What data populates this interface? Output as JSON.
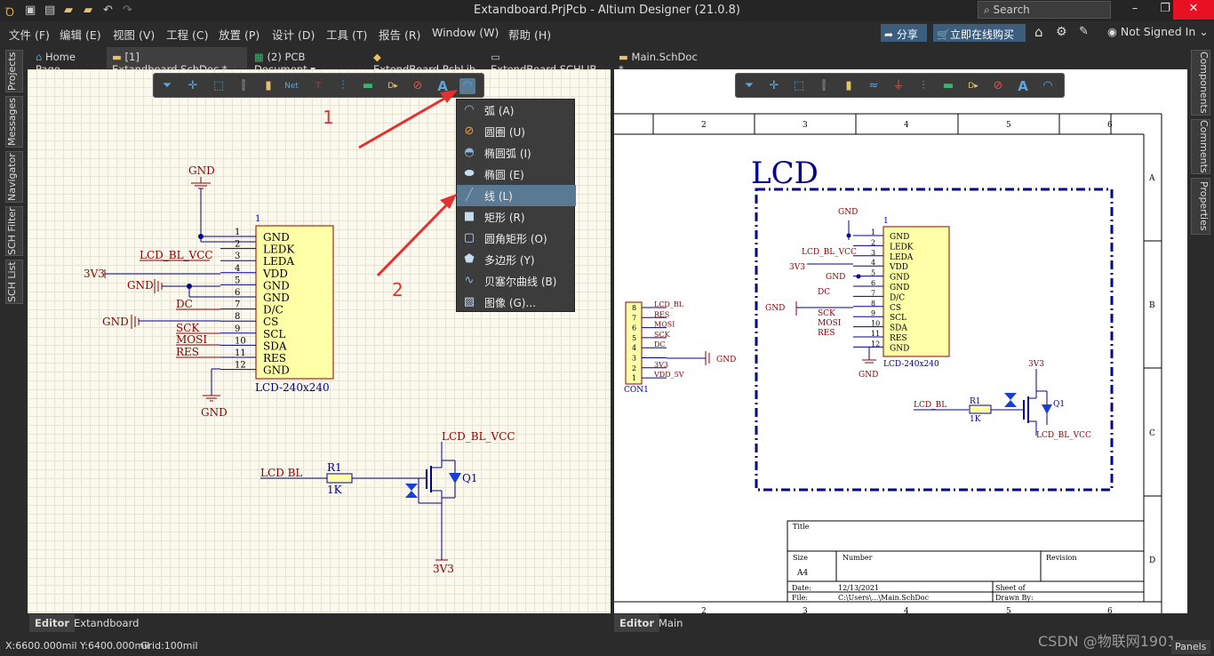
{
  "window": {
    "title": "Extandboard.PrjPcb - Altium Designer (21.0.8)",
    "search_placeholder": "Search",
    "min": "–",
    "max": "❐",
    "close": "✕"
  },
  "menu": {
    "items": [
      "文件 (F)",
      "编辑 (E)",
      "视图 (V)",
      "工程 (C)",
      "放置 (P)",
      "设计 (D)",
      "工具 (T)",
      "报告 (R)",
      "Window (W)",
      "帮助 (H)"
    ],
    "share": "分享",
    "buy": "立即在线购买",
    "user": "Not Signed In"
  },
  "tabs": [
    "Home Page",
    "[1] Extandboard.SchDoc *",
    "(2) PCB Document",
    "ExtendBoard.PcbLib",
    "ExtendBoard.SCHLIB",
    "Main.SchDoc *"
  ],
  "left_panels": [
    "Projects",
    "Messages",
    "Navigator",
    "SCH Filter",
    "SCH List"
  ],
  "right_panels": [
    "Components",
    "Comments",
    "Properties"
  ],
  "dropdown": {
    "items": [
      {
        "label": "弧 (A)",
        "icon": "arc-icon"
      },
      {
        "label": "圆圈 (U)",
        "icon": "circle-icon"
      },
      {
        "label": "椭圆弧 (I)",
        "icon": "elliptical-arc-icon"
      },
      {
        "label": "椭圆 (E)",
        "icon": "ellipse-icon"
      },
      {
        "label": "线 (L)",
        "icon": "line-icon"
      },
      {
        "label": "矩形 (R)",
        "icon": "rectangle-icon"
      },
      {
        "label": "圆角矩形 (O)",
        "icon": "round-rectangle-icon"
      },
      {
        "label": "多边形 (Y)",
        "icon": "polygon-icon"
      },
      {
        "label": "贝塞尔曲线 (B)",
        "icon": "bezier-icon"
      },
      {
        "label": "图像 (G)...",
        "icon": "image-icon"
      }
    ],
    "highlighted_index": 4
  },
  "annotations": {
    "step1": "1",
    "step2": "2"
  },
  "schematic_left": {
    "gnd": "GND",
    "v33": "3V3",
    "lcd_bl_vcc": "LCD_BL_VCC",
    "lcd_bl": "LCD BL",
    "dc": "DC",
    "sck": "SCK",
    "mosi": "MOSI",
    "res": "RES",
    "part": "LCD-240x240",
    "designator": "1",
    "r1": "R1",
    "r1v": "1K",
    "q1": "Q1",
    "pins": [
      {
        "n": "1",
        "name": "GND"
      },
      {
        "n": "2",
        "name": "LEDK"
      },
      {
        "n": "3",
        "name": "LEDA"
      },
      {
        "n": "4",
        "name": "VDD"
      },
      {
        "n": "5",
        "name": "GND"
      },
      {
        "n": "6",
        "name": "GND"
      },
      {
        "n": "7",
        "name": "D/C"
      },
      {
        "n": "8",
        "name": "CS"
      },
      {
        "n": "9",
        "name": "SCL"
      },
      {
        "n": "10",
        "name": "SDA"
      },
      {
        "n": "11",
        "name": "RES"
      },
      {
        "n": "12",
        "name": "GND"
      }
    ]
  },
  "schematic_right": {
    "title": "LCD",
    "cols": [
      "2",
      "3",
      "4",
      "5",
      "6"
    ],
    "rows": [
      "A",
      "B",
      "C",
      "D"
    ],
    "con": "CON1",
    "con_pins": [
      "8",
      "7",
      "6",
      "5",
      "4",
      "3",
      "2",
      "1"
    ],
    "con_nets": [
      "LCD_BL",
      "RES",
      "MOSI",
      "SCK",
      "DC",
      "",
      "3V3",
      "VDD_5V"
    ],
    "lcd_bl": "LCD_BL",
    "tb_title": "Title",
    "tb_size": "Size",
    "tb_a4": "A4",
    "tb_number": "Number",
    "tb_revision": "Revision",
    "tb_date": "Date:",
    "tb_date_v": "12/13/2021",
    "tb_sheet": "Sheet  of",
    "tb_file": "File:",
    "tb_file_v": "C:\\Users\\...\\Main.SchDoc",
    "tb_drawn": "Drawn By:"
  },
  "editor_tabs_left": [
    "Editor",
    "Extandboard"
  ],
  "editor_tabs_right": [
    "Editor",
    "Main"
  ],
  "status": {
    "coords": "X:6600.000mil Y:6400.000mil",
    "grid": "Grid:100mil",
    "panels": "Panels"
  },
  "watermark": "CSDN @物联网1901"
}
